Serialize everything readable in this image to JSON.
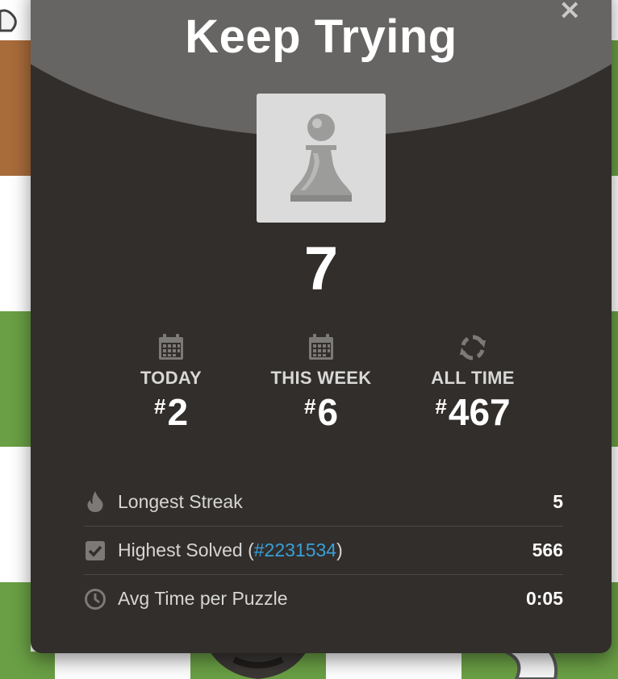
{
  "modal": {
    "title": "Keep Trying",
    "close_glyph": "×",
    "piece_icon": "pawn-icon",
    "score": "7"
  },
  "ranks": [
    {
      "icon": "calendar-icon",
      "label": "TODAY",
      "hash": "#",
      "value": "2"
    },
    {
      "icon": "calendar-icon",
      "label": "THIS WEEK",
      "hash": "#",
      "value": "6"
    },
    {
      "icon": "refresh-icon",
      "label": "ALL TIME",
      "hash": "#",
      "value": "467"
    }
  ],
  "stats": {
    "longest_streak": {
      "icon": "flame-icon",
      "label": "Longest Streak",
      "value": "5"
    },
    "highest_solved": {
      "icon": "checkbox-icon",
      "label_prefix": "Highest Solved (",
      "link": "#2231534",
      "label_suffix": ")",
      "value": "566"
    },
    "avg_time": {
      "icon": "clock-icon",
      "label": "Avg Time per Puzzle",
      "value": "0:05"
    }
  },
  "colors": {
    "modal_bg": "#312e2b",
    "header_arc": "#666564",
    "link": "#3b9fd8",
    "board_green": "#6a9f45",
    "board_light": "#ffffff",
    "board_brown": "#a86b3a"
  }
}
